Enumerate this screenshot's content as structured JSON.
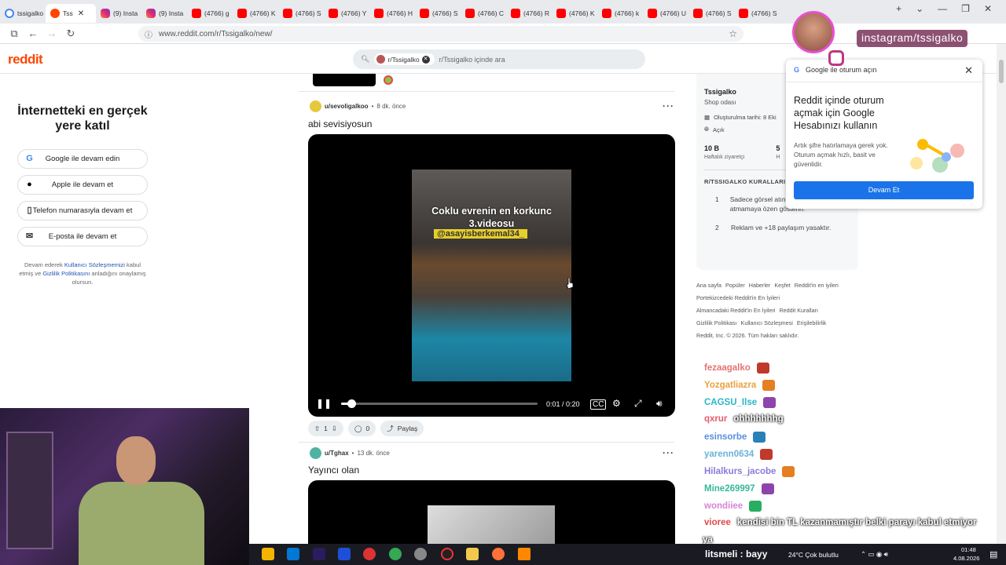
{
  "browser": {
    "tabs": [
      {
        "label": "tssigalko",
        "icon": "google-icon",
        "active": false
      },
      {
        "label": "Tss",
        "icon": "reddit-icon",
        "active": true
      },
      {
        "label": "(9) Insta",
        "icon": "instagram-icon",
        "active": false
      },
      {
        "label": "(9) Insta",
        "icon": "instagram-icon",
        "active": false
      },
      {
        "label": "(4766) g",
        "icon": "youtube-icon",
        "active": false
      },
      {
        "label": "(4766) K",
        "icon": "youtube-icon",
        "active": false
      },
      {
        "label": "(4766) S",
        "icon": "youtube-icon",
        "active": false
      },
      {
        "label": "(4766) Y",
        "icon": "youtube-icon",
        "active": false
      },
      {
        "label": "(4766) H",
        "icon": "youtube-icon",
        "active": false
      },
      {
        "label": "(4766) S",
        "icon": "youtube-icon",
        "active": false
      },
      {
        "label": "(4766) C",
        "icon": "youtube-icon",
        "active": false
      },
      {
        "label": "(4766) R",
        "icon": "youtube-icon",
        "active": false
      },
      {
        "label": "(4766) K",
        "icon": "youtube-icon",
        "active": false
      },
      {
        "label": "(4766) k",
        "icon": "youtube-icon",
        "active": false
      },
      {
        "label": "(4766) U",
        "icon": "youtube-icon",
        "active": false
      },
      {
        "label": "(4766) S",
        "icon": "youtube-icon",
        "active": false
      },
      {
        "label": "(4766) S",
        "icon": "youtube-icon",
        "active": false
      }
    ],
    "url": "www.reddit.com/r/Tssigalko/new/"
  },
  "reddit": {
    "logo": "reddit",
    "search_chip": "r/Tssigalko",
    "search_placeholder": "r/Tssigalko içinde ara"
  },
  "login_panel": {
    "heading": "İnternetteki en gerçek yere katıl",
    "buttons": [
      {
        "label": "Google ile devam edin",
        "icon": "google-icon"
      },
      {
        "label": "Apple ile devam et",
        "icon": "apple-icon"
      },
      {
        "label": "Telefon numarasıyla devam et",
        "icon": "phone-icon"
      },
      {
        "label": "E-posta ile devam et",
        "icon": "mail-icon"
      }
    ],
    "fine_pre": "Devam ederek ",
    "fine_link1": "Kullanıcı Sözleşmemizi",
    "fine_mid": " kabul etmiş ve ",
    "fine_link2": "Gizlilik Politikasını",
    "fine_post": " anladığını onaylamış olursun."
  },
  "posts": [
    {
      "user": "u/sevoligalkoo",
      "time": "8 dk. önce",
      "title": "abi sevisiyosun",
      "video": {
        "caption_line1": "Coklu evrenin en korkunc",
        "caption_line2": "3.videosu",
        "tag": "@asayisberkemal34_",
        "time": "0:01 / 0:20",
        "progress": 0.05
      },
      "votes": "1",
      "comments": "0",
      "share": "Paylaş"
    },
    {
      "user": "u/Tghax",
      "time": "13 dk. önce",
      "title": "Yayıncı olan"
    }
  ],
  "sidebar": {
    "name": "Tssigalko",
    "subtitle": "Shop odası",
    "created": "Oluşturulma tarihi: 8 Eki",
    "visibility": "Açık",
    "stat1_num": "10 B",
    "stat1_lbl": "Haftalık ziyaretçi",
    "stat2_num": "5",
    "stat2_lbl": "H",
    "rules_title": "R/TSSIGALKO KURALLARI",
    "rules": [
      {
        "n": "1",
        "text": "Sadece görsel atın. Ayrıca spam atmamaya özen gösterin."
      },
      {
        "n": "2",
        "text": "Reklam ve +18 paylaşım yasaktır."
      }
    ],
    "footer_lines": [
      [
        "Ana sayfa",
        "Popüler",
        "Haberler",
        "Keşfet",
        "Reddit'in en iyileri"
      ],
      [
        "Portekizcedeki Reddit'in En İyileri"
      ],
      [
        "Almancadaki Reddit'in En İyileri",
        "Reddit Kuralları"
      ],
      [
        "Gizlilik Politikası",
        "Kullanıcı Sözleşmesi",
        "Erişilebilirlik"
      ],
      [
        "Reddit, Inc. © 2026. Tüm hakları saklıdır."
      ]
    ]
  },
  "google_popup": {
    "header": "Google ile oturum açın",
    "title": "Reddit içinde oturum açmak için Google Hesabınızı kullanın",
    "body": "Artık şifre hatırlamaya gerek yok. Oturum açmak hızlı, basit ve güvenlidir.",
    "button": "Devam Et"
  },
  "instagram_overlay": {
    "label": "instagram/tssigalko"
  },
  "chat": [
    {
      "name": "fezaagalko",
      "msg": "",
      "color": "#e57373"
    },
    {
      "name": "Yozgatliazra",
      "msg": "",
      "color": "#e8a33c"
    },
    {
      "name": "CAGSU_Ilse",
      "msg": "",
      "color": "#29b6c6"
    },
    {
      "name": "qxrur",
      "msg": "ohhhhhhhg",
      "color": "#e65b6c"
    },
    {
      "name": "esinsorbe",
      "msg": "",
      "color": "#5a8fe0"
    },
    {
      "name": "yarenn0634",
      "msg": "",
      "color": "#6bb3d6"
    },
    {
      "name": "Hilalkurs_jacobe",
      "msg": "",
      "color": "#8c7ad8"
    },
    {
      "name": "Mine269997",
      "msg": "",
      "color": "#35b89a"
    },
    {
      "name": "wondiiee",
      "msg": "",
      "color": "#d684d8"
    },
    {
      "name": "vioree",
      "msg": "kendisi bin TL kazanmamıştır belki parayı kabul etmiyor",
      "color": "#e04848"
    },
    {
      "name": "",
      "msg": "ya",
      "color": "#ffffff"
    }
  ],
  "taskbar": {
    "ticker": "litsmeli : bayy",
    "weather": "24°C  Çok bulutlu",
    "time": "01:48",
    "date": "4.08.2026"
  }
}
